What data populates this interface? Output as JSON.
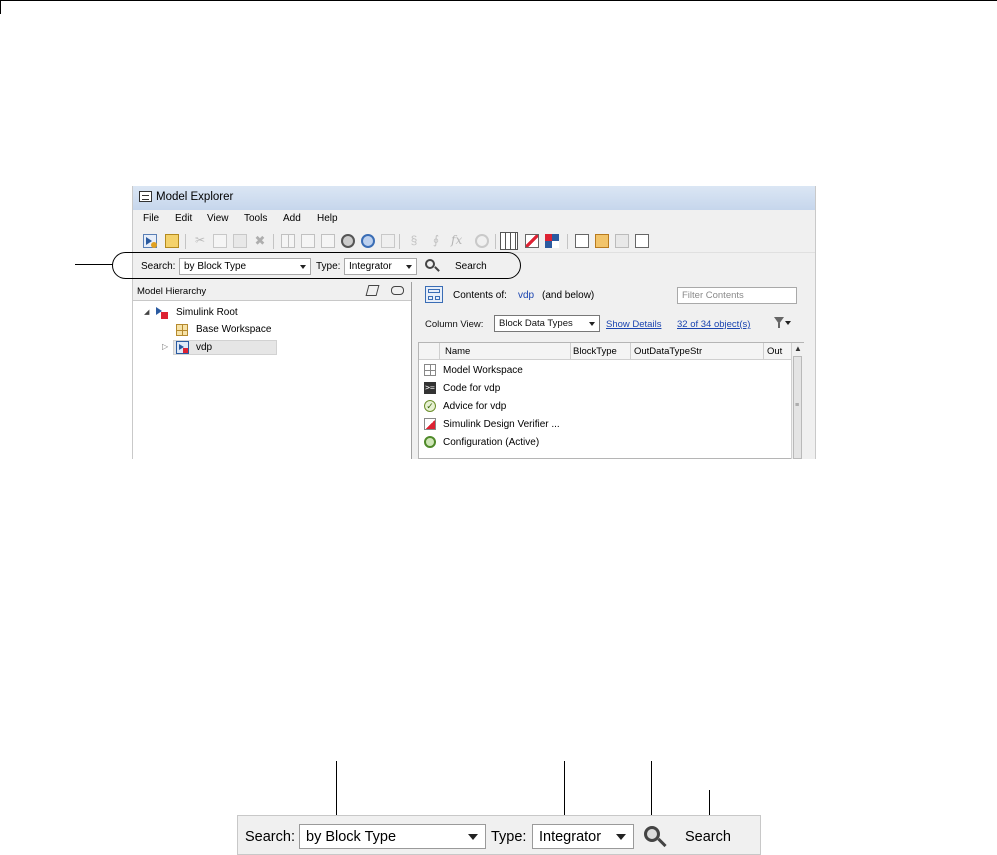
{
  "window": {
    "title": "Model Explorer",
    "menu": [
      "File",
      "Edit",
      "View",
      "Tools",
      "Add",
      "Help"
    ]
  },
  "search_bar": {
    "search_label": "Search:",
    "search_by_value": "by Block Type",
    "type_label": "Type:",
    "type_value": "Integrator",
    "search_button_label": "Search"
  },
  "model_hierarchy": {
    "header": "Model Hierarchy",
    "nodes": [
      {
        "label": "Simulink Root",
        "icon": "simulink-root-icon"
      },
      {
        "label": "Base Workspace",
        "icon": "base-workspace-icon"
      },
      {
        "label": "vdp",
        "icon": "model-icon",
        "selected": true
      }
    ]
  },
  "contents": {
    "prefix": "Contents of:",
    "model_link": "vdp",
    "suffix": "(and below)",
    "filter_placeholder": "Filter Contents",
    "column_view_label": "Column View:",
    "column_view_value": "Block Data Types",
    "show_details": "Show Details",
    "object_count": "32 of 34 object(s)",
    "columns": [
      "Name",
      "BlockType",
      "OutDataTypeStr",
      "Out"
    ],
    "rows": [
      {
        "label": "Model Workspace",
        "icon": "model-workspace-icon"
      },
      {
        "label": "Code for vdp",
        "icon": "code-icon"
      },
      {
        "label": "Advice for vdp",
        "icon": "advice-icon"
      },
      {
        "label": "Simulink Design Verifier ...",
        "icon": "design-verifier-icon"
      },
      {
        "label": "Configuration (Active)",
        "icon": "configuration-icon"
      }
    ]
  },
  "zoomed_search_bar": {
    "search_label": "Search:",
    "search_by_value": "by Block Type",
    "type_label": "Type:",
    "type_value": "Integrator",
    "search_button_label": "Search"
  },
  "colors": {
    "link": "#1a44b0",
    "window_bg": "#f0f0f0",
    "titlebar": "#c6d6ec",
    "selection": "#e6e6e6"
  }
}
